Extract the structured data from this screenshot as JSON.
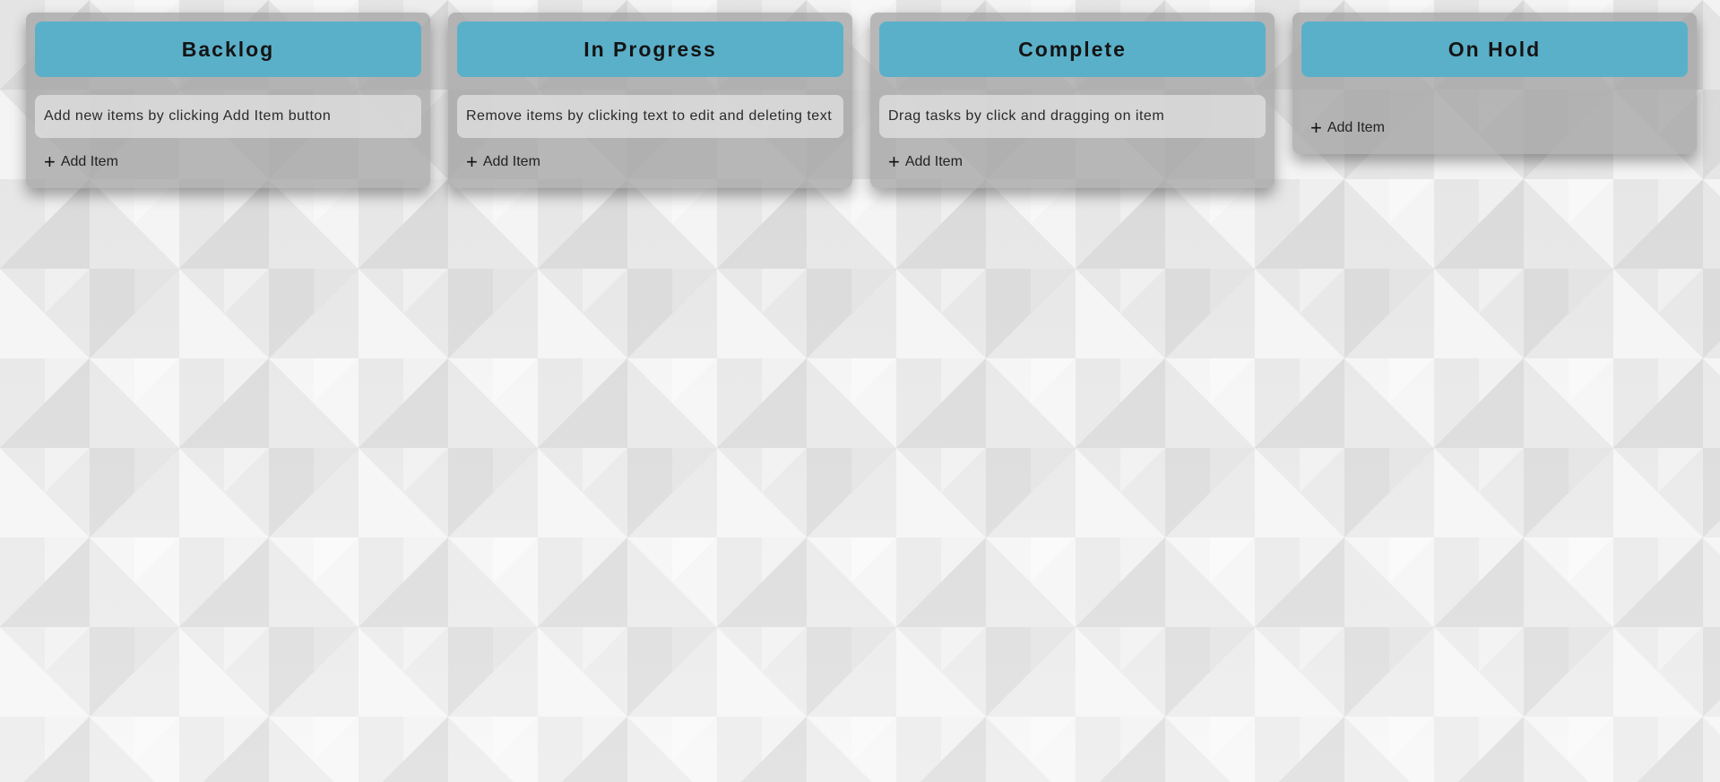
{
  "board": {
    "add_label": "Add Item",
    "columns": [
      {
        "title": "Backlog",
        "items": [
          "Add new items by clicking Add Item button"
        ]
      },
      {
        "title": "In Progress",
        "items": [
          "Remove items by clicking text to edit and deleting text"
        ]
      },
      {
        "title": "Complete",
        "items": [
          "Drag tasks by click and dragging on item"
        ]
      },
      {
        "title": "On Hold",
        "items": []
      }
    ]
  },
  "colors": {
    "header": "#5bb0c9",
    "column_bg": "#a0a0a0"
  },
  "icons": {
    "add": "plus-icon"
  }
}
